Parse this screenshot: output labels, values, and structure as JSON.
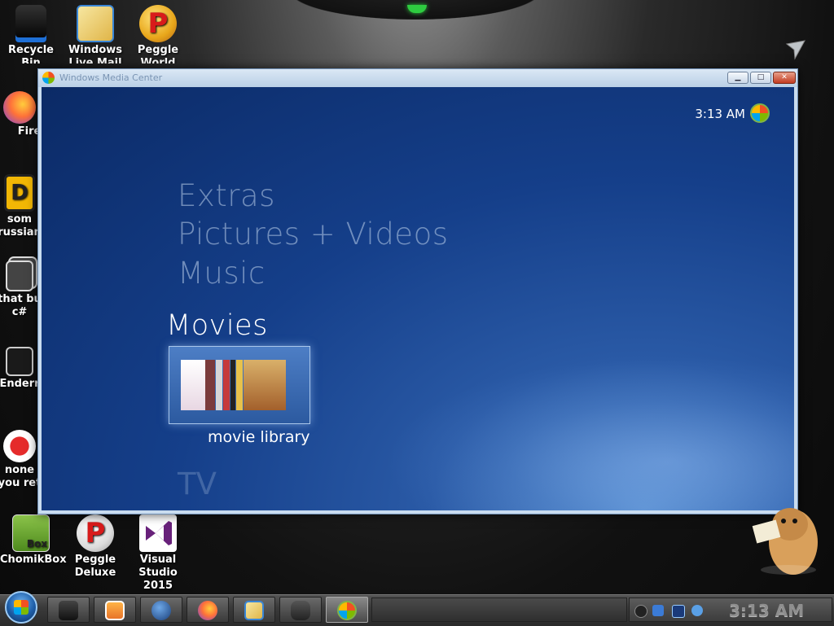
{
  "desktop": {
    "icons": [
      {
        "label1": "Recycle",
        "label2": "Bin",
        "icon": "recycle-bin-icon"
      },
      {
        "label1": "Windows",
        "label2": "Live Mail",
        "icon": "mail-icon"
      },
      {
        "label1": "Peggle",
        "label2": "World",
        "icon": "peggle-icon"
      },
      {
        "label1": "Firef",
        "label2": "",
        "icon": "firefox-icon"
      },
      {
        "label1": "som",
        "label2": "russian",
        "icon": "doc-icon"
      },
      {
        "label1": "that bu",
        "label2": "c#",
        "icon": "stack-icon"
      },
      {
        "label1": "Enderr",
        "label2": "",
        "icon": "terminal-icon"
      },
      {
        "label1": "none",
        "label2": "you ret",
        "icon": "dino-icon"
      },
      {
        "label1": "ChomikBox",
        "label2": "",
        "icon": "chomikbox-icon"
      },
      {
        "label1": "Peggle",
        "label2": "Deluxe",
        "icon": "peggle-deluxe-icon"
      },
      {
        "label1": "Visual",
        "label2": "Studio 2015",
        "icon": "visual-studio-icon"
      }
    ]
  },
  "window": {
    "title": "Windows Media Center",
    "controls": {
      "minimize": "▁",
      "maximize": "□",
      "close": "✕"
    }
  },
  "media_center": {
    "clock": "3:13 AM",
    "menu": [
      {
        "label": "Extras",
        "active": false
      },
      {
        "label": "Pictures + Videos",
        "active": false
      },
      {
        "label": "Music",
        "active": false
      },
      {
        "label": "Movies",
        "active": true
      }
    ],
    "selected_tile_label": "movie library",
    "next_item": "TV"
  },
  "taskbar": {
    "clock": "3:13 AM",
    "buttons": [
      "explorer-icon",
      "media-player-icon",
      "globe-icon",
      "firefox-icon",
      "mail-icon",
      "chomik-icon",
      "windows-media-center-icon"
    ]
  }
}
